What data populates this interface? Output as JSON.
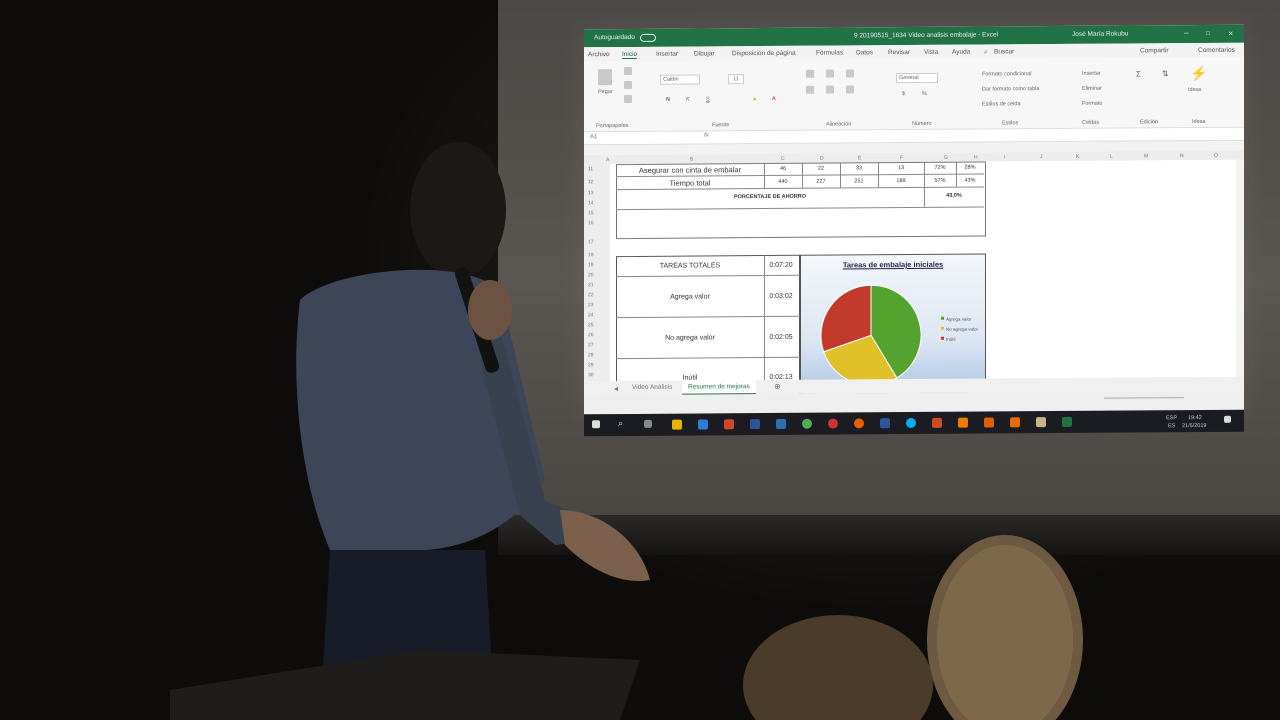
{
  "excel": {
    "title": "9 20190515_1634 Video analisis embalaje - Excel",
    "user": "José María Rokubu",
    "autosave_label": "Autoguardado",
    "tabs": [
      "Archivo",
      "Inicio",
      "Insertar",
      "Dibujar",
      "Disposición de página",
      "Fórmulas",
      "Datos",
      "Revisar",
      "Vista",
      "Ayuda",
      "Buscar"
    ],
    "share_label": "Compartir",
    "comments_label": "Comentarios",
    "ribbon": {
      "paste_label": "Pegar",
      "font_name": "Calibri",
      "font_size": "11",
      "number_format": "General",
      "conditional_format": "Formato condicional",
      "format_as_table": "Dar formato como tabla",
      "cell_styles": "Estilos de celda",
      "insert": "Insertar",
      "delete": "Eliminar",
      "format": "Formato",
      "ideas": "Ideas",
      "groups": [
        "Portapapeles",
        "Fuente",
        "Alineación",
        "Número",
        "Estilos",
        "Celdas",
        "Edición",
        "Ideas"
      ]
    },
    "name_box": "A1",
    "columns": [
      "A",
      "B",
      "C",
      "D",
      "E",
      "F",
      "G",
      "H",
      "I",
      "J",
      "K",
      "L",
      "M",
      "N",
      "O",
      "P"
    ],
    "rows": [
      "11",
      "12",
      "13",
      "14",
      "15",
      "16",
      "17",
      "18",
      "19",
      "20",
      "21",
      "22",
      "23",
      "24",
      "25",
      "26",
      "27",
      "28",
      "29",
      "30"
    ],
    "summary_rows": [
      {
        "label": "Asegurar con cinta de embalar",
        "c": "46",
        "d": "22",
        "e": "33",
        "f": "13",
        "g": "72%",
        "h": "28%"
      },
      {
        "label": "Tiempo total",
        "c": "440",
        "d": "227",
        "e": "251",
        "f": "189",
        "g": "57%",
        "h": "43%"
      }
    ],
    "savings_label": "PORCENTAJE DE AHORRO",
    "savings_value": "43,0%",
    "tasks_table": [
      {
        "label": "TAREAS TOTALES",
        "time": "0:07:20"
      },
      {
        "label": "Agrega valor",
        "time": "0:03:02"
      },
      {
        "label": "No agrega valor",
        "time": "0:02:05"
      },
      {
        "label": "Inútil",
        "time": "0:02:13"
      }
    ],
    "sheet_tabs": [
      "Video Análisis",
      "Resumen de mejoras"
    ],
    "chart_data": {
      "type": "pie",
      "title": "Tareas de embalaje iniciales",
      "categories": [
        "Agrega valor",
        "No agrega valor",
        "Inútil"
      ],
      "values": [
        182,
        125,
        133
      ],
      "colors": [
        "#55a32f",
        "#e1c12a",
        "#c0392b"
      ],
      "legend_position": "right"
    },
    "taskbar": {
      "language": "ESP",
      "language_sub": "ES",
      "time": "19:42",
      "date": "21/5/2019"
    }
  }
}
